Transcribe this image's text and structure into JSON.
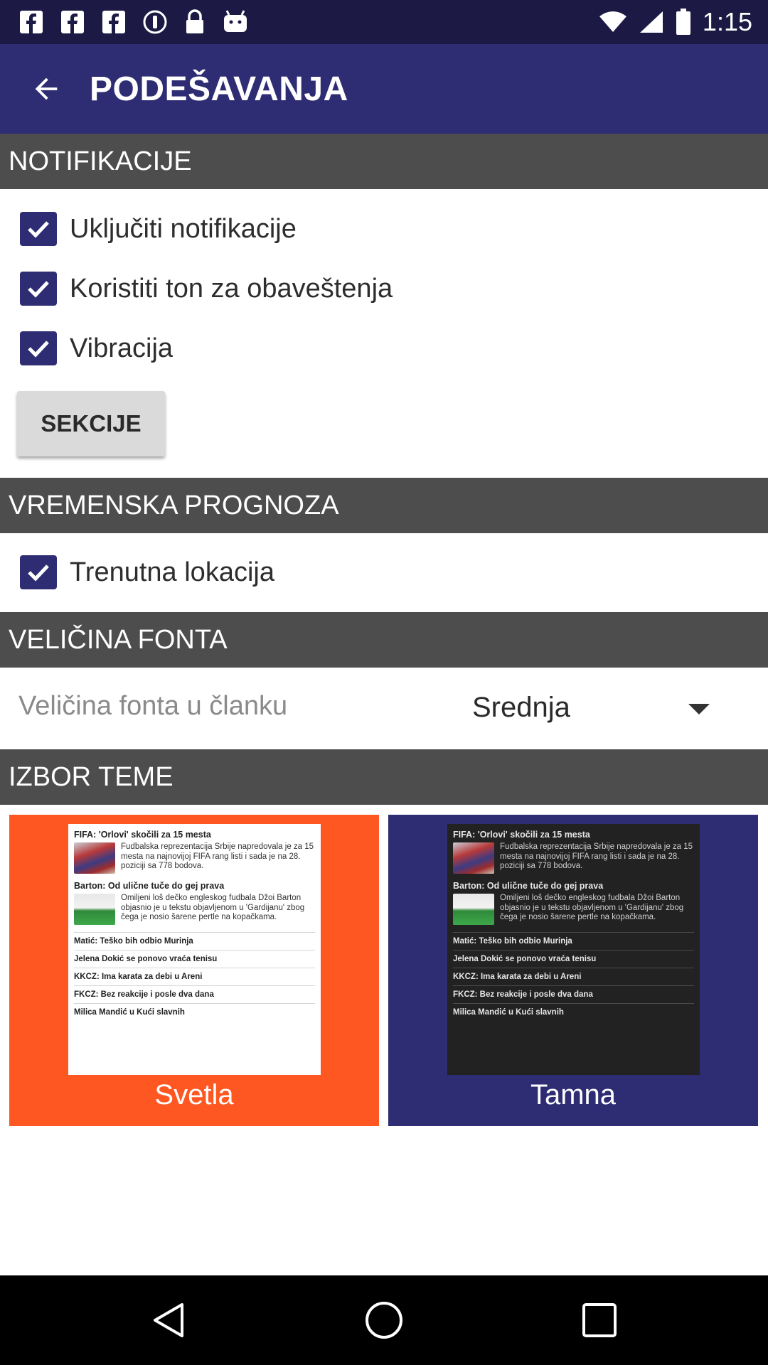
{
  "status_bar": {
    "time": "1:15",
    "left_icons": [
      "facebook-icon",
      "facebook-icon",
      "facebook-icon",
      "vpn-icon",
      "lock-icon",
      "android-icon"
    ],
    "right_icons": [
      "wifi-icon",
      "signal-icon",
      "battery-icon"
    ]
  },
  "app_bar": {
    "title": "PODEŠAVANJA",
    "back_icon": "arrow-back-icon",
    "background": "#2e2c73"
  },
  "sections": {
    "notifications": {
      "header": "NOTIFIKACIJE",
      "items": [
        {
          "label": "Uključiti notifikacije",
          "checked": true
        },
        {
          "label": "Koristiti ton za obaveštenja",
          "checked": true
        },
        {
          "label": "Vibracija",
          "checked": true
        }
      ],
      "button": "SEKCIJE"
    },
    "weather": {
      "header": "VREMENSKA PROGNOZA",
      "items": [
        {
          "label": "Trenutna lokacija",
          "checked": true
        }
      ]
    },
    "font_size": {
      "header": "VELIČINA FONTA",
      "label": "Veličina fonta u članku",
      "selected": "Srednja"
    },
    "theme": {
      "header": "IZBOR TEME",
      "options": [
        {
          "label": "Svetla",
          "color": "#ff5722"
        },
        {
          "label": "Tamna",
          "color": "#2e2c73"
        }
      ]
    }
  },
  "preview": {
    "article1_title": "FIFA: 'Orlovi' skočili za 15 mesta",
    "article1_text": "Fudbalska reprezentacija Srbije napredovala je za 15 mesta na najnovijoj FIFA rang listi i sada je na 28. poziciji sa 778 bodova.",
    "article2_title": "Barton: Od ulične tuče do gej prava",
    "article2_text": "Omiljeni loš dečko engleskog fudbala Džoi Barton objasnio je u tekstu objavljenom u 'Gardijanu' zbog čega je nosio šarene pertle na kopačkama.",
    "headlines": [
      "Matić: Teško bih odbio Murinja",
      "Jelena Dokić se ponovo vraća tenisu",
      "KKCZ: Ima karata za debi u Areni",
      "FKCZ: Bez reakcije i posle dva dana",
      "Milica Mandić u Kući slavnih"
    ]
  },
  "nav_bar": {
    "icons": [
      "back-triangle-icon",
      "home-circle-icon",
      "recents-square-icon"
    ]
  }
}
